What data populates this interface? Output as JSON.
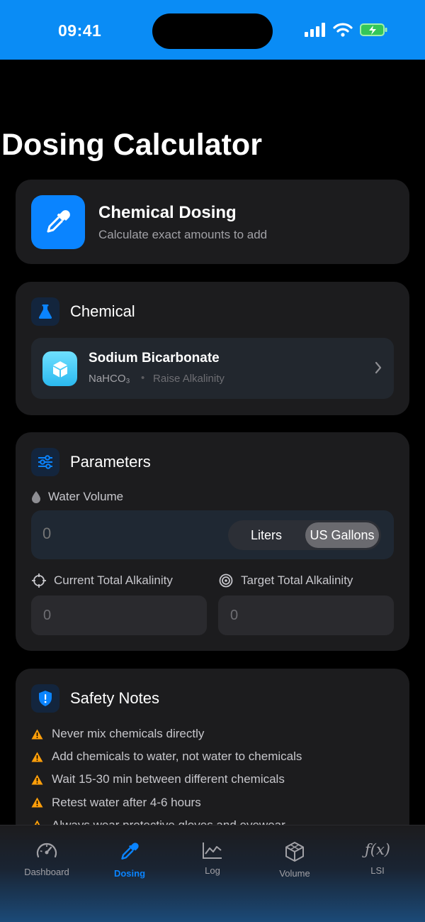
{
  "status": {
    "time": "09:41"
  },
  "page": {
    "title": "Dosing Calculator"
  },
  "hero": {
    "title": "Chemical Dosing",
    "subtitle": "Calculate exact amounts to add",
    "icon": "dropper-icon"
  },
  "chemical_section": {
    "title": "Chemical",
    "selected": {
      "name": "Sodium Bicarbonate",
      "formula": "NaHCO₃",
      "separator": "•",
      "purpose": "Raise Alkalinity"
    }
  },
  "parameters": {
    "title": "Parameters",
    "water_volume": {
      "label": "Water Volume",
      "placeholder": "0",
      "units": [
        "Liters",
        "US Gallons"
      ],
      "selected_unit": "US Gallons"
    },
    "current_ta": {
      "label": "Current Total Alkalinity",
      "value": "0"
    },
    "target_ta": {
      "label": "Target Total Alkalinity",
      "value": "0"
    }
  },
  "safety": {
    "title": "Safety Notes",
    "items": [
      "Never mix chemicals directly",
      "Add chemicals to water, not water to chemicals",
      "Wait 15-30 min between different chemicals",
      "Retest water after 4-6 hours",
      "Always wear protective gloves and eyewear"
    ]
  },
  "tabs": [
    {
      "label": "Dashboard",
      "icon": "gauge-icon",
      "active": false
    },
    {
      "label": "Dosing",
      "icon": "dropper-icon",
      "active": true
    },
    {
      "label": "Log",
      "icon": "chart-line-icon",
      "active": false
    },
    {
      "label": "Volume",
      "icon": "cube-icon",
      "active": false
    },
    {
      "label": "LSI",
      "icon": "function-icon",
      "active": false
    }
  ],
  "colors": {
    "accent": "#0a84ff",
    "status_bar": "#0a8cf5",
    "warning": "#ff9f0a"
  }
}
